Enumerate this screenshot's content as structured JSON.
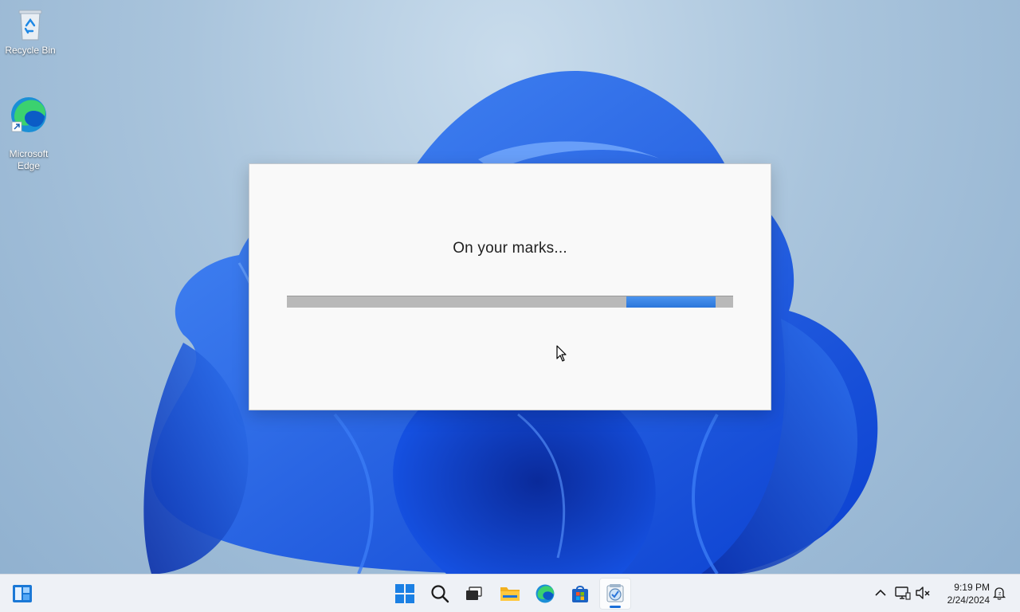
{
  "desktop": {
    "icons": [
      {
        "label": "Recycle Bin",
        "icon": "recycle-bin-icon"
      },
      {
        "label": "Microsoft\nEdge",
        "icon": "edge-icon"
      }
    ]
  },
  "loader": {
    "message": "On your marks...",
    "progress": {
      "fill_start_fraction": 0.76,
      "fill_end_fraction": 0.96,
      "mode": "indeterminate"
    }
  },
  "taskbar": {
    "apps": [
      {
        "icon": "widgets-icon"
      },
      {
        "icon": "windows-start-icon"
      },
      {
        "icon": "search-icon"
      },
      {
        "icon": "task-view-icon"
      },
      {
        "icon": "file-explorer-icon"
      },
      {
        "icon": "edge-icon"
      },
      {
        "icon": "microsoft-store-icon"
      },
      {
        "icon": "setup-app-icon",
        "active": true
      }
    ],
    "tray": [
      {
        "icon": "chevron-up-icon"
      },
      {
        "icon": "network-icon"
      },
      {
        "icon": "volume-muted-icon"
      },
      {
        "icon": "notifications-icon"
      }
    ],
    "clock": {
      "time": "9:19 PM",
      "date": "2/24/2024"
    }
  },
  "colors": {
    "accent": "#2b76db",
    "progress_track": "#b9b9b9",
    "dialog_background": "#f9f9f9",
    "taskbar_background": "#eef1f6"
  }
}
